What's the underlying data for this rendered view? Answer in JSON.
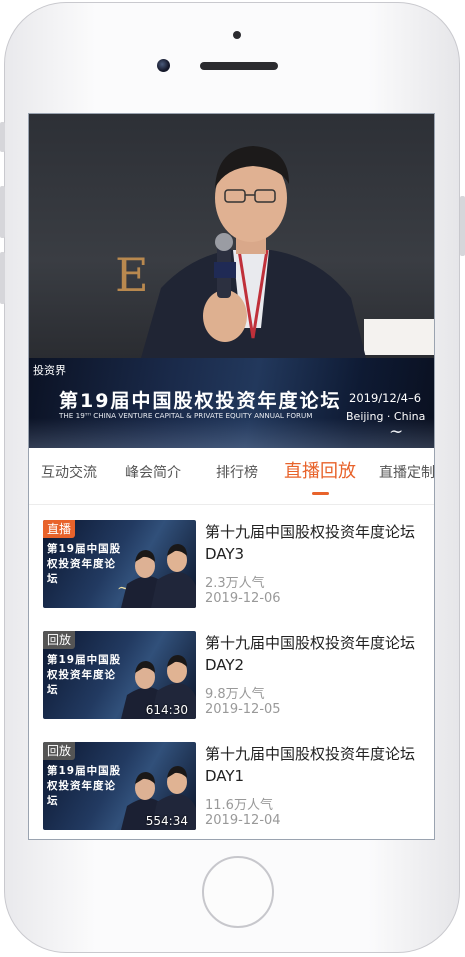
{
  "video": {
    "banner": {
      "logo_text": "投资界",
      "title_cn": "第19届中国股权投资年度论坛",
      "title_en": "THE 19ᵀᴴ CHINA VENTURE CAPITAL & PRIVATE EQUITY ANNUAL FORUM",
      "date": "2019/12/4–6",
      "place": "Beijing · China"
    }
  },
  "tabs": [
    {
      "label": "互动交流",
      "active": false
    },
    {
      "label": "峰会简介",
      "active": false
    },
    {
      "label": "排行榜",
      "active": false
    },
    {
      "label": "直播回放",
      "active": true
    },
    {
      "label": "直播定制",
      "active": false
    }
  ],
  "items": [
    {
      "badge": "直播",
      "badge_type": "live",
      "title": "第十九届中国股权投资年度论坛DAY3",
      "popularity": "2.3万人气",
      "date": "2019-12-06",
      "duration": "",
      "thumb_title": "第19届中国股权投资年度论坛"
    },
    {
      "badge": "回放",
      "badge_type": "replay",
      "title": "第十九届中国股权投资年度论坛DAY2",
      "popularity": "9.8万人气",
      "date": "2019-12-05",
      "duration": "614:30",
      "thumb_title": "第19届中国股权投资年度论坛"
    },
    {
      "badge": "回放",
      "badge_type": "replay",
      "title": "第十九届中国股权投资年度论坛DAY1",
      "popularity": "11.6万人气",
      "date": "2019-12-04",
      "duration": "554:34",
      "thumb_title": "第19届中国股权投资年度论坛"
    }
  ],
  "colors": {
    "accent": "#e8632b",
    "replay_badge": "#555555",
    "muted_text": "#999999"
  }
}
